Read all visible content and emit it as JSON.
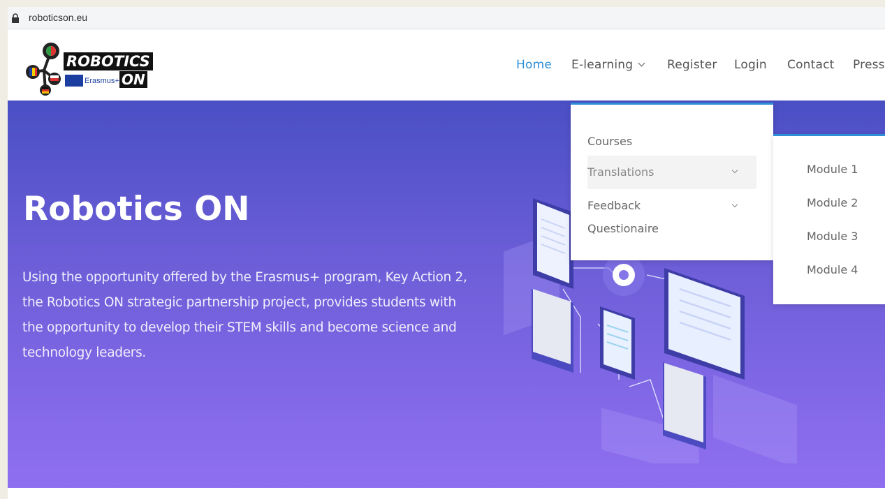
{
  "browser": {
    "url": "roboticson.eu"
  },
  "logo": {
    "title": "ROBOTICS",
    "erasmus": "Erasmus+",
    "on": "ON"
  },
  "nav": {
    "items": [
      {
        "label": "Home",
        "active": true
      },
      {
        "label": "E-learning",
        "has_dropdown": true
      },
      {
        "label": "Register"
      },
      {
        "label": "Login"
      },
      {
        "label": "Contact"
      },
      {
        "label": "Press"
      }
    ]
  },
  "elearning_menu": {
    "items": [
      {
        "label": "Courses"
      },
      {
        "label": "Translations",
        "has_submenu": true
      },
      {
        "label": "Feedback",
        "has_submenu": true
      },
      {
        "label": "Questionaire"
      }
    ]
  },
  "translations_menu": {
    "items": [
      {
        "label": "Module 1"
      },
      {
        "label": "Module 2"
      },
      {
        "label": "Module 3"
      },
      {
        "label": "Module 4"
      }
    ]
  },
  "hero": {
    "title": "Robotics ON",
    "text": "Using the opportunity offered by the Erasmus+ program, Key Action 2, the Robotics ON strategic partnership project, provides students with the opportunity to develop their STEM skills and become science and technology leaders."
  },
  "colors": {
    "accent": "#2e8fd6",
    "hero_top": "#4a4fc4",
    "hero_bottom": "#8f6ff0"
  }
}
